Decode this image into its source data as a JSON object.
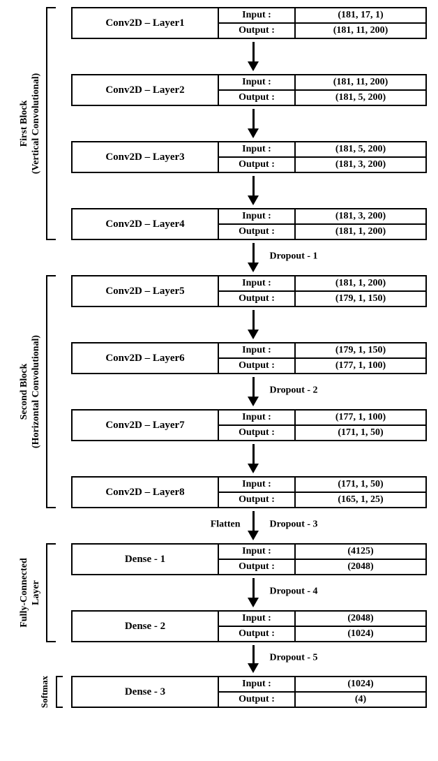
{
  "labels": {
    "input": "Input :",
    "output": "Output :"
  },
  "blocks": {
    "b1": {
      "line1": "First Block",
      "line2": "(Vertical Convolutional)"
    },
    "b2": {
      "line1": "Second Block",
      "line2": "(Horizontal Convolutional)"
    },
    "b3": {
      "line1": "Fully-Connected",
      "line2": "Layer"
    },
    "b4": {
      "line1": "Softmax"
    }
  },
  "layers": {
    "l1": {
      "name": "Conv2D – Layer1",
      "in": "(181, 17, 1)",
      "out": "(181, 11, 200)"
    },
    "l2": {
      "name": "Conv2D – Layer2",
      "in": "(181, 11, 200)",
      "out": "(181, 5, 200)"
    },
    "l3": {
      "name": "Conv2D – Layer3",
      "in": "(181, 5, 200)",
      "out": "(181, 3, 200)"
    },
    "l4": {
      "name": "Conv2D – Layer4",
      "in": "(181, 3, 200)",
      "out": "(181, 1, 200)"
    },
    "l5": {
      "name": "Conv2D – Layer5",
      "in": "(181, 1, 200)",
      "out": "(179, 1, 150)"
    },
    "l6": {
      "name": "Conv2D – Layer6",
      "in": "(179, 1, 150)",
      "out": "(177, 1, 100)"
    },
    "l7": {
      "name": "Conv2D – Layer7",
      "in": "(177, 1, 100)",
      "out": "(171, 1, 50)"
    },
    "l8": {
      "name": "Conv2D – Layer8",
      "in": "(171, 1, 50)",
      "out": "(165, 1, 25)"
    },
    "d1": {
      "name": "Dense - 1",
      "in": "(4125)",
      "out": "(2048)"
    },
    "d2": {
      "name": "Dense - 2",
      "in": "(2048)",
      "out": "(1024)"
    },
    "d3": {
      "name": "Dense - 3",
      "in": "(1024)",
      "out": "(4)"
    }
  },
  "annotations": {
    "drop1": "Dropout - 1",
    "drop2": "Dropout - 2",
    "drop3": "Dropout - 3",
    "drop4": "Dropout - 4",
    "drop5": "Dropout - 5",
    "flatten": "Flatten"
  },
  "chart_data": {
    "type": "diagram",
    "architecture": [
      {
        "block": "First Block (Vertical Convolutional)",
        "layers": [
          {
            "op": "Conv2D",
            "id": 1,
            "in": [
              181,
              17,
              1
            ],
            "out": [
              181,
              11,
              200
            ]
          },
          {
            "op": "Conv2D",
            "id": 2,
            "in": [
              181,
              11,
              200
            ],
            "out": [
              181,
              5,
              200
            ]
          },
          {
            "op": "Conv2D",
            "id": 3,
            "in": [
              181,
              5,
              200
            ],
            "out": [
              181,
              3,
              200
            ]
          },
          {
            "op": "Conv2D",
            "id": 4,
            "in": [
              181,
              3,
              200
            ],
            "out": [
              181,
              1,
              200
            ]
          },
          {
            "op": "Dropout",
            "id": 1
          }
        ]
      },
      {
        "block": "Second Block (Horizontal Convolutional)",
        "layers": [
          {
            "op": "Conv2D",
            "id": 5,
            "in": [
              181,
              1,
              200
            ],
            "out": [
              179,
              1,
              150
            ]
          },
          {
            "op": "Conv2D",
            "id": 6,
            "in": [
              179,
              1,
              150
            ],
            "out": [
              177,
              1,
              100
            ]
          },
          {
            "op": "Dropout",
            "id": 2
          },
          {
            "op": "Conv2D",
            "id": 7,
            "in": [
              177,
              1,
              100
            ],
            "out": [
              171,
              1,
              50
            ]
          },
          {
            "op": "Conv2D",
            "id": 8,
            "in": [
              171,
              1,
              50
            ],
            "out": [
              165,
              1,
              25
            ]
          },
          {
            "op": "Flatten"
          },
          {
            "op": "Dropout",
            "id": 3
          }
        ]
      },
      {
        "block": "Fully-Connected Layer",
        "layers": [
          {
            "op": "Dense",
            "id": 1,
            "in": [
              4125
            ],
            "out": [
              2048
            ]
          },
          {
            "op": "Dropout",
            "id": 4
          },
          {
            "op": "Dense",
            "id": 2,
            "in": [
              2048
            ],
            "out": [
              1024
            ]
          },
          {
            "op": "Dropout",
            "id": 5
          }
        ]
      },
      {
        "block": "Softmax",
        "layers": [
          {
            "op": "Dense",
            "id": 3,
            "in": [
              1024
            ],
            "out": [
              4
            ]
          }
        ]
      }
    ]
  }
}
